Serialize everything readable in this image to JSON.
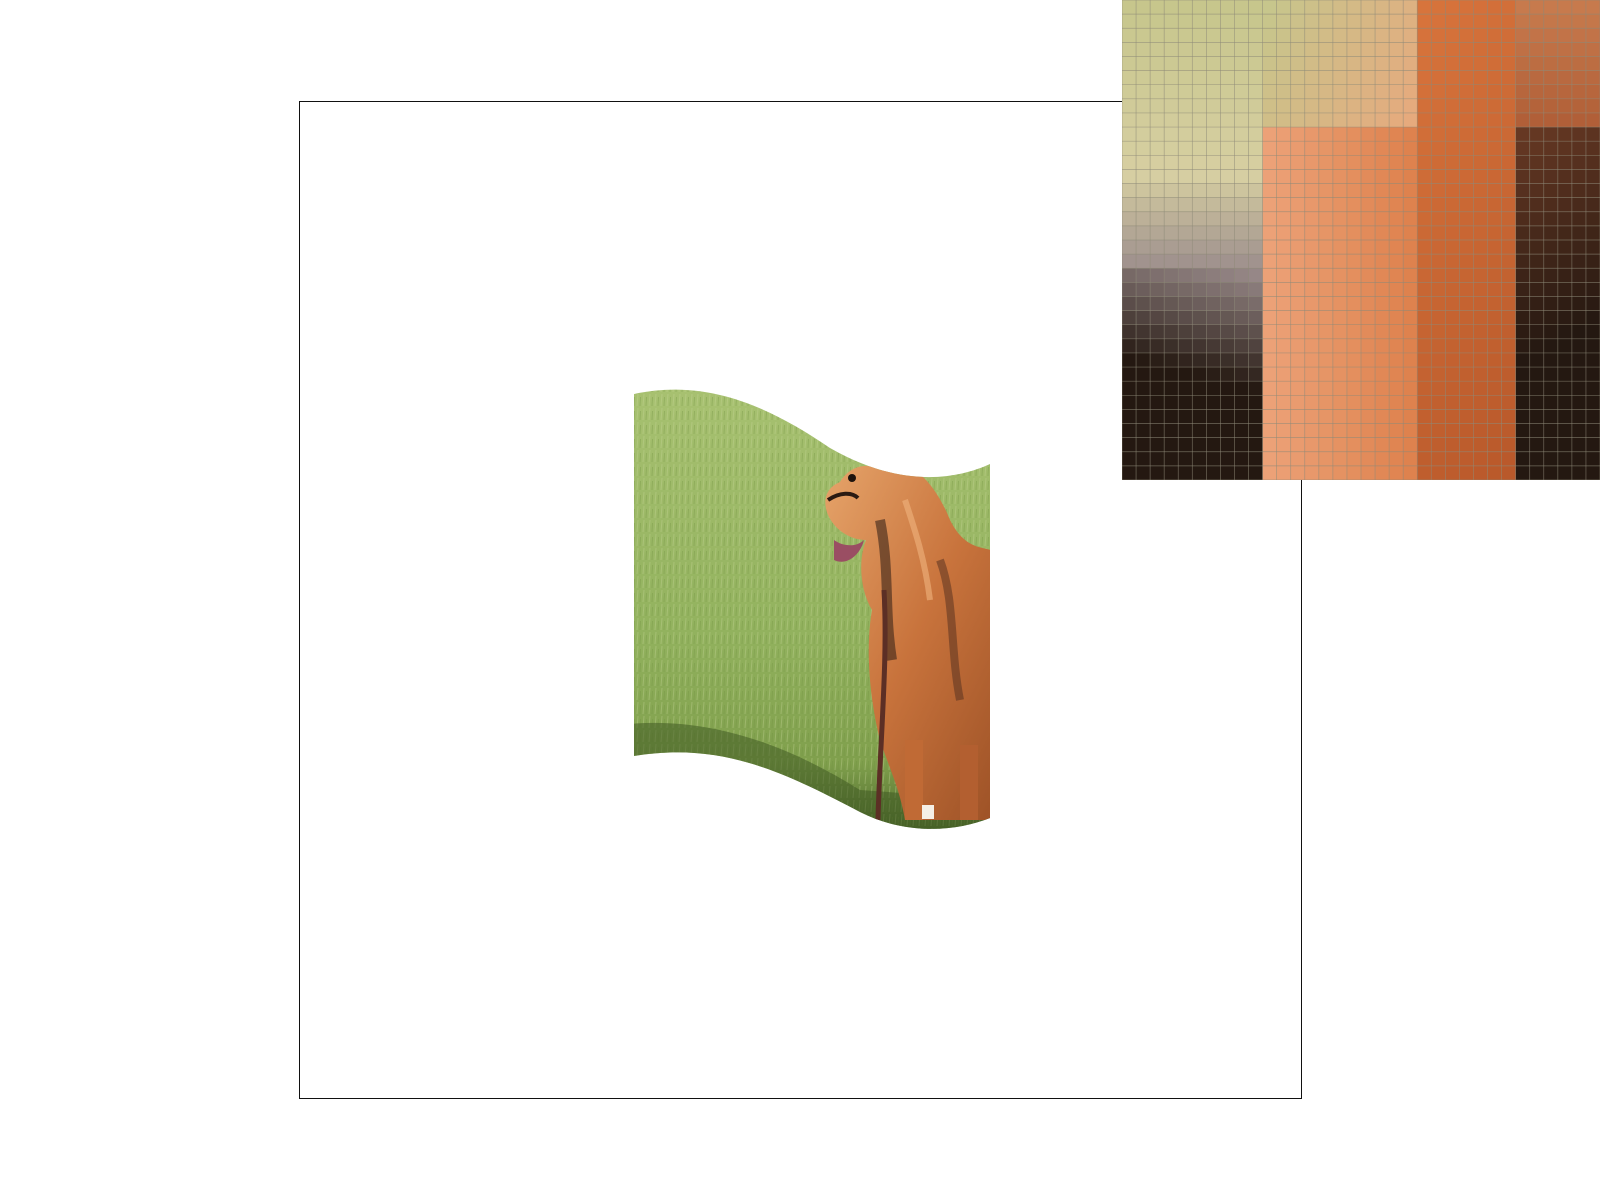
{
  "scene": {
    "subject_icon": "dog-on-grass-image",
    "background_color": "#ffffff",
    "frame_color": "#111111"
  },
  "colors": {
    "grass_light": "#a9c272",
    "grass_mid": "#8fb05a",
    "grass_dark": "#5f7d34",
    "fur_light": "#e09a5e",
    "fur_mid": "#c8733c",
    "fur_dark": "#3a2419",
    "tongue": "#9a4e63",
    "loupe_green": "#c7c68c",
    "loupe_peach": "#eda47a",
    "loupe_orange": "#d8743c",
    "loupe_dark": "#241811",
    "loupe_grey": "#9b8c8c",
    "loupe_grid": "#8e8a78"
  },
  "loupe": {
    "grid_columns": 34,
    "grid_rows": 34
  }
}
